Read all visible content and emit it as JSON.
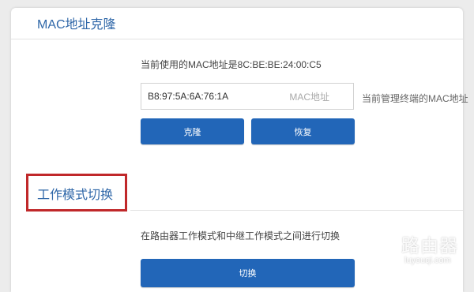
{
  "mac_clone": {
    "title": "MAC地址克隆",
    "current_mac_text": "当前使用的MAC地址是8C:BE:BE:24:00:C5",
    "input_value": "B8:97:5A:6A:76:1A",
    "input_label": "MAC地址",
    "input_hint": "当前管理终端的MAC地址",
    "clone_button": "克隆",
    "restore_button": "恢复"
  },
  "work_mode": {
    "title": "工作模式切换",
    "description": "在路由器工作模式和中继工作模式之间进行切换",
    "switch_button": "切换"
  },
  "watermark": {
    "text": "路由器",
    "url": "luyouqi.com"
  },
  "colors": {
    "accent": "#2266b8",
    "title": "#2f67a8",
    "highlight": "#c0282a"
  }
}
